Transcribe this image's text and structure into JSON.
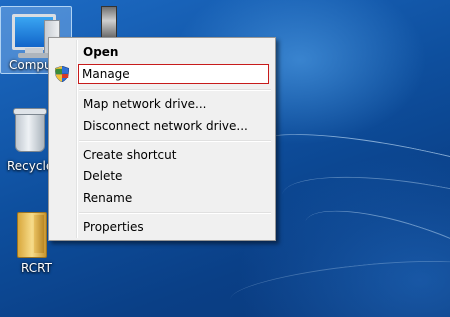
{
  "desktop": {
    "icons": [
      {
        "label": "Compu",
        "icon": "computer-icon"
      },
      {
        "label": "Recycle",
        "icon": "recycle-bin-icon"
      },
      {
        "label": "RCRT",
        "icon": "folder-icon"
      }
    ]
  },
  "context_menu": {
    "items": [
      {
        "label": "Open"
      },
      {
        "label": "Manage",
        "icon": "uac-shield-icon"
      },
      {
        "label": "Map network drive..."
      },
      {
        "label": "Disconnect network drive..."
      },
      {
        "label": "Create shortcut"
      },
      {
        "label": "Delete"
      },
      {
        "label": "Rename"
      },
      {
        "label": "Properties"
      }
    ]
  },
  "colors": {
    "desktop_blue": "#0e4f9e",
    "menu_background": "#f0f0f0",
    "highlight_border": "#c71b1b"
  }
}
